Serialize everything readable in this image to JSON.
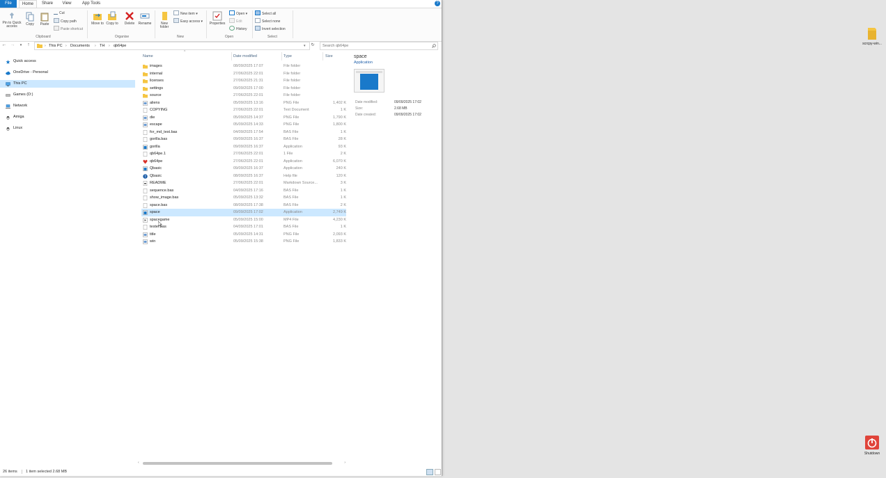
{
  "ribbon_tabs": [
    {
      "label": "File"
    },
    {
      "label": "Home"
    },
    {
      "label": "Share"
    },
    {
      "label": "View"
    },
    {
      "label": "App Tools"
    }
  ],
  "ribbon": {
    "clipboard": {
      "pin_label": "Pin to Quick access",
      "copy_label": "Copy",
      "paste_label": "Paste",
      "cut_label": "Cut",
      "copy_path_label": "Copy path",
      "paste_shortcut_label": "Paste shortcut",
      "group_label": "Clipboard"
    },
    "organise": {
      "move_to_label": "Move to",
      "copy_to_label": "Copy to",
      "delete_label": "Delete",
      "rename_label": "Rename",
      "group_label": "Organise"
    },
    "new": {
      "new_folder_label": "New folder",
      "new_item_label": "New item",
      "easy_access_label": "Easy access",
      "group_label": "New"
    },
    "open": {
      "properties_label": "Properties",
      "open_label": "Open",
      "edit_label": "Edit",
      "history_label": "History",
      "group_label": "Open"
    },
    "select": {
      "select_all_label": "Select all",
      "select_none_label": "Select none",
      "invert_label": "Invert selection",
      "group_label": "Select"
    }
  },
  "breadcrumb": [
    "This PC",
    "Documents",
    "TH",
    "qb64pe"
  ],
  "search": {
    "placeholder": "Search qb64pe"
  },
  "nav_pane": [
    {
      "label": "Quick access",
      "icon": "star-icon"
    },
    {
      "label": "OneDrive - Personal",
      "icon": "cloud-icon"
    },
    {
      "label": "This PC",
      "icon": "computer-icon",
      "selected": true
    },
    {
      "label": "Games (D:)",
      "icon": "drive-icon"
    },
    {
      "label": "Network",
      "icon": "network-icon"
    },
    {
      "label": "Amiga",
      "icon": "linux-icon"
    },
    {
      "label": "Linux",
      "icon": "linux-icon"
    }
  ],
  "columns": {
    "name": "Name",
    "date": "Date modified",
    "type": "Type",
    "size": "Size"
  },
  "files": [
    {
      "name": "images",
      "date": "08/09/2025 17:07",
      "type": "File folder",
      "size": "",
      "icon": "folder"
    },
    {
      "name": "internal",
      "date": "27/06/2025 22:01",
      "type": "File folder",
      "size": "",
      "icon": "folder"
    },
    {
      "name": "licenses",
      "date": "27/06/2025 21:31",
      "type": "File folder",
      "size": "",
      "icon": "folder"
    },
    {
      "name": "settings",
      "date": "09/09/2025 17:00",
      "type": "File folder",
      "size": "",
      "icon": "folder"
    },
    {
      "name": "source",
      "date": "27/06/2025 22:01",
      "type": "File folder",
      "size": "",
      "icon": "folder"
    },
    {
      "name": "aliens",
      "date": "05/09/2025 13:16",
      "type": "PNG File",
      "size": "1,402 K",
      "icon": "image"
    },
    {
      "name": "COPYING",
      "date": "27/06/2025 22:01",
      "type": "Text Document",
      "size": "1 K",
      "icon": "doc"
    },
    {
      "name": "die",
      "date": "05/09/2025 14:37",
      "type": "PNG File",
      "size": "1,790 K",
      "icon": "image"
    },
    {
      "name": "escape",
      "date": "05/09/2025 14:33",
      "type": "PNG File",
      "size": "1,800 K",
      "icon": "image"
    },
    {
      "name": "for_md_test.bas",
      "date": "04/09/2025 17:54",
      "type": "BAS File",
      "size": "1 K",
      "icon": "doc"
    },
    {
      "name": "gorilla.bas",
      "date": "09/09/2025 16:37",
      "type": "BAS File",
      "size": "28 K",
      "icon": "doc"
    },
    {
      "name": "gorilla",
      "date": "09/09/2025 16:37",
      "type": "Application",
      "size": "93 K",
      "icon": "app"
    },
    {
      "name": "qb64pe.1",
      "date": "27/06/2025 22:01",
      "type": "1 File",
      "size": "2 K",
      "icon": "doc"
    },
    {
      "name": "qb64pe",
      "date": "27/06/2025 22:01",
      "type": "Application",
      "size": "6,070 K",
      "icon": "qb64"
    },
    {
      "name": "Qbasic",
      "date": "09/09/2025 16:37",
      "type": "Application",
      "size": "240 K",
      "icon": "app"
    },
    {
      "name": "Qbasic",
      "date": "08/09/2025 16:37",
      "type": "Help file",
      "size": "120 K",
      "icon": "help"
    },
    {
      "name": "README",
      "date": "27/06/2025 22:01",
      "type": "Markdown Source...",
      "size": "3 K",
      "icon": "md"
    },
    {
      "name": "sequence.bas",
      "date": "04/09/2025 17:16",
      "type": "BAS File",
      "size": "1 K",
      "icon": "doc"
    },
    {
      "name": "show_image.bas",
      "date": "05/09/2025 13:32",
      "type": "BAS File",
      "size": "1 K",
      "icon": "doc"
    },
    {
      "name": "space.bas",
      "date": "08/09/2025 17:38",
      "type": "BAS File",
      "size": "2 K",
      "icon": "doc"
    },
    {
      "name": "space",
      "date": "09/09/2025 17:02",
      "type": "Application",
      "size": "2,749 K",
      "icon": "app",
      "selected": true
    },
    {
      "name": "spacegame",
      "date": "05/09/2025 15:00",
      "type": "MP4 File",
      "size": "4,230 K",
      "icon": "video"
    },
    {
      "name": "tester.bas",
      "date": "04/09/2025 17:01",
      "type": "BAS File",
      "size": "1 K",
      "icon": "doc"
    },
    {
      "name": "title",
      "date": "05/09/2025 14:31",
      "type": "PNG File",
      "size": "2,093 K",
      "icon": "image"
    },
    {
      "name": "win",
      "date": "05/09/2025 15:38",
      "type": "PNG File",
      "size": "1,833 K",
      "icon": "image"
    }
  ],
  "preview": {
    "title": "space",
    "subtitle": "Application",
    "meta": [
      {
        "label": "Date modified:",
        "value": "09/09/2025 17:02"
      },
      {
        "label": "Size:",
        "value": "2.68 MB"
      },
      {
        "label": "Date created:",
        "value": "09/09/2025 17:02"
      }
    ]
  },
  "status": {
    "items": "26 items",
    "selection": "1 item selected  2.68 MB"
  },
  "desktop": {
    "folder_label": "scrcpy-win...",
    "shutdown_label": "Shutdown"
  },
  "colors": {
    "accent": "#1979ca",
    "selected": "#cce8ff",
    "folder": "#f5c542",
    "shutdown": "#e0443a"
  }
}
